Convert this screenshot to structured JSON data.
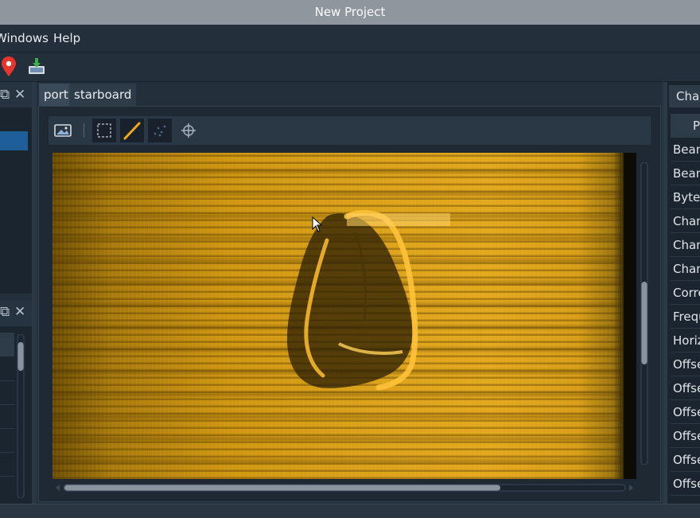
{
  "window": {
    "title": "New Project"
  },
  "menubar": {
    "items": [
      {
        "label": "Windows"
      },
      {
        "label": "Help"
      }
    ]
  },
  "toolbar": {
    "icons": [
      "map-marker-icon",
      "download-image-icon"
    ]
  },
  "center": {
    "tabs": [
      {
        "label": "port"
      },
      {
        "label": "starboard"
      }
    ],
    "active_tab": "port",
    "image_tools": [
      "image-icon",
      "select-rect-icon",
      "draw-line-icon",
      "scatter-icon",
      "crosshair-icon"
    ],
    "colors": {
      "sonar_palette": "#e3a81d"
    }
  },
  "right_panel": {
    "tab_label": "Channel",
    "header_label": "Property",
    "rows": [
      "Beam",
      "Beam",
      "Bytes",
      "Chan",
      "Chan",
      "Chan",
      "Corre",
      "Frequ",
      "Horiz",
      "Offse",
      "Offse",
      "Offse",
      "Offse",
      "Offse",
      "Offse"
    ]
  }
}
